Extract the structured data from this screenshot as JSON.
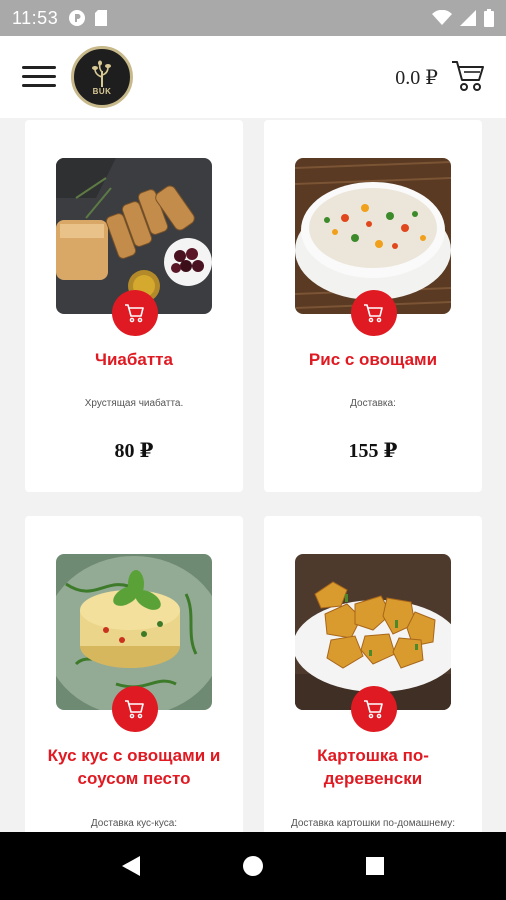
{
  "status_bar": {
    "time": "11:53"
  },
  "header": {
    "logo_text": "BUK",
    "cart_total": "0.0 ₽"
  },
  "products": [
    {
      "title": "Чиабатта",
      "description": "Хрустящая чиабатта.",
      "price": "80 ₽"
    },
    {
      "title": "Рис с овощами",
      "description": "Доставка:",
      "price": "155 ₽"
    },
    {
      "title": "Кус кус с овощами и соусом песто",
      "description": "Доставка кус-куса:",
      "price": ""
    },
    {
      "title": "Картошка по-деревенски",
      "description": "Доставка картошки по-домашнему:",
      "price": ""
    }
  ],
  "colors": {
    "accent": "#e01a22",
    "status_bar": "#a9a9a9",
    "background": "#f2f2f2"
  },
  "icons": [
    "menu-icon",
    "logo-tree-icon",
    "cart-icon",
    "add-to-cart-icon",
    "back-icon",
    "home-icon",
    "recents-icon",
    "wifi-icon",
    "signal-icon",
    "battery-icon"
  ]
}
